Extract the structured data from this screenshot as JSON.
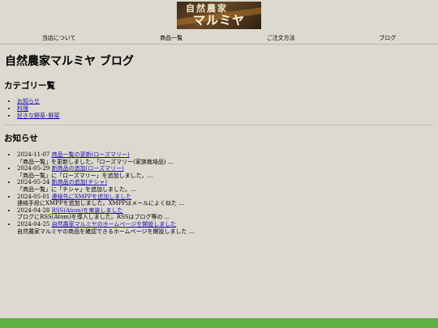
{
  "logo": {
    "line1": "自然農家",
    "line2": "マルミヤ"
  },
  "nav": {
    "items": [
      {
        "label": "当店について"
      },
      {
        "label": "商品一覧"
      },
      {
        "label": "ご注文方法"
      },
      {
        "label": "ブログ"
      }
    ]
  },
  "page": {
    "title": "自然農家マルミヤ ブログ"
  },
  "categories": {
    "heading": "カテゴリー覧",
    "items": [
      {
        "label": "お知らせ"
      },
      {
        "label": "料理"
      },
      {
        "label": "好きな野草･野菜"
      }
    ]
  },
  "news": {
    "heading": "お知らせ",
    "items": [
      {
        "date": "2024-11-07",
        "title": "商品一覧の更新(ローズマリー)",
        "summary": "「商品一覧」を更新しました。「ローズマリー(家族栽培品) ..."
      },
      {
        "date": "2024-05-29",
        "title": "新商品の追加(ローズマリー)",
        "summary": "「商品一覧」に「ローズマリー」を追加しました。..."
      },
      {
        "date": "2024-05-24",
        "title": "新商品の追加(チシャ)",
        "summary": "「商品一覧」に「チシャ」を追加しました。..."
      },
      {
        "date": "2024-05-01",
        "title": "連絡先にXMPPを追加しました",
        "summary": "連絡手段にXMPPを追加しました。XMPPはメールによく似た ..."
      },
      {
        "date": "2024-04-28",
        "title": "RSS(Atom)を実装しました",
        "summary": "ブログにRSS(Atom)を導入しました。RSSはブログ等の ..."
      },
      {
        "date": "2024-04-25",
        "title": "自然農家マルミヤのホームページを開設しました",
        "summary": "自然農家マルミヤの商品を確認できるホームページを開設しました ..."
      }
    ]
  },
  "colors": {
    "background": "#dcdad0",
    "link": "#1a0dab",
    "footer": "#5db046"
  }
}
